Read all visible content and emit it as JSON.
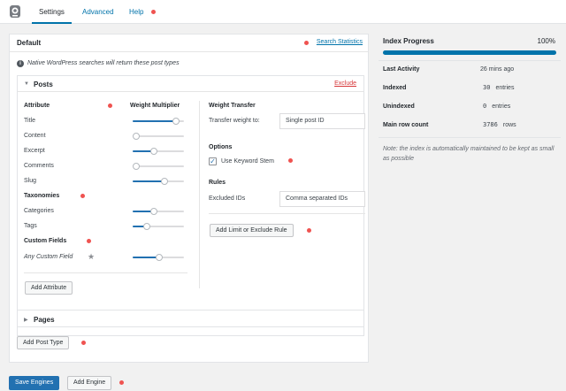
{
  "tabs": [
    {
      "label": "Settings",
      "active": true
    },
    {
      "label": "Advanced",
      "active": false
    },
    {
      "label": "Help",
      "active": false
    }
  ],
  "engine": {
    "title": "Default",
    "stats_link": "Search Statistics",
    "notice": "Native WordPress searches will return these post types"
  },
  "posts": {
    "title": "Posts",
    "exclude": "Exclude",
    "attr_header": "Attribute",
    "weight_header": "Weight Multiplier",
    "attributes": [
      {
        "label": "Title",
        "weight": 0.85
      },
      {
        "label": "Content",
        "weight": 0.0
      },
      {
        "label": "Excerpt",
        "weight": 0.42
      },
      {
        "label": "Comments",
        "weight": 0.0
      },
      {
        "label": "Slug",
        "weight": 0.62
      }
    ],
    "taxonomies_header": "Taxonomies",
    "taxonomies": [
      {
        "label": "Categories",
        "weight": 0.42
      },
      {
        "label": "Tags",
        "weight": 0.28
      }
    ],
    "custom_header": "Custom Fields",
    "custom_fields": [
      {
        "label": "Any Custom Field",
        "weight": 0.52
      }
    ],
    "add_attribute": "Add Attribute",
    "weight_transfer_header": "Weight Transfer",
    "transfer_label": "Transfer weight to:",
    "transfer_value": "Single post ID",
    "options_header": "Options",
    "keyword_stem": "Use Keyword Stem",
    "keyword_stem_checked": true,
    "rules_header": "Rules",
    "excluded_label": "Excluded IDs",
    "excluded_placeholder": "Comma separated IDs",
    "add_rule": "Add Limit or Exclude Rule"
  },
  "pages": {
    "title": "Pages"
  },
  "buttons": {
    "add_post_type": "Add Post Type",
    "save_engines": "Save Engines",
    "add_engine": "Add Engine"
  },
  "progress": {
    "title": "Index Progress",
    "percent_label": "100%",
    "percent": 1.0,
    "stats": [
      {
        "label": "Last Activity",
        "value": "26 mins ago",
        "code": "",
        "unit": ""
      },
      {
        "label": "Indexed",
        "value": "",
        "code": "30",
        "unit": "entries"
      },
      {
        "label": "Unindexed",
        "value": "",
        "code": "0",
        "unit": "entries"
      },
      {
        "label": "Main row count",
        "value": "",
        "code": "3786",
        "unit": "rows"
      }
    ],
    "note": "Note: the index is automatically maintained to be kept as small as possible"
  },
  "colors": {
    "accent": "#0073aa",
    "marker": "#ef5350"
  }
}
